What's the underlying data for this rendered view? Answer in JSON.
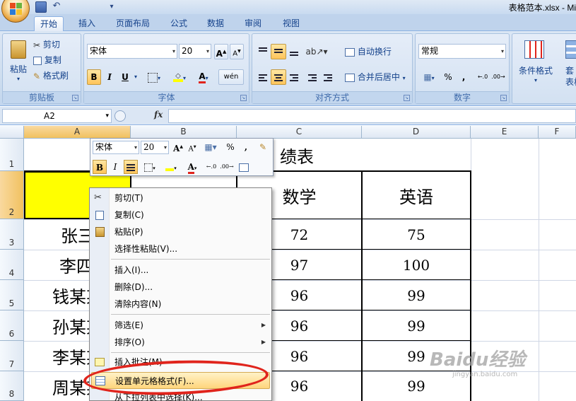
{
  "window": {
    "title": "表格范本.xlsx - Mi"
  },
  "tabs": [
    "开始",
    "插入",
    "页面布局",
    "公式",
    "数据",
    "审阅",
    "视图"
  ],
  "ribbon": {
    "clipboard": {
      "paste": "粘贴",
      "cut": "剪切",
      "copy": "复制",
      "format_painter": "格式刷",
      "label": "剪贴板"
    },
    "font": {
      "name": "宋体",
      "size": "20",
      "bold": "B",
      "italic": "I",
      "underline": "U",
      "color_a": "A",
      "label": "字体",
      "wen": "wén"
    },
    "alignment": {
      "wrap": "自动换行",
      "merge": "合并后居中",
      "label": "对齐方式"
    },
    "number": {
      "format": "常规",
      "percent": "%",
      "comma": ",",
      "label": "数字"
    },
    "styles": {
      "conditional": "条件格式",
      "table": "套",
      "table2": "表格格"
    }
  },
  "formula_bar": {
    "name_box": "A2",
    "fx": "fx"
  },
  "columns": [
    "A",
    "B",
    "C",
    "D",
    "E",
    "F"
  ],
  "rows": [
    "1",
    "2",
    "3",
    "4",
    "5",
    "6",
    "7",
    "8"
  ],
  "sheet": {
    "title_fragment": "绩表",
    "headers": {
      "math": "数学",
      "english": "英语"
    },
    "names": [
      "张三",
      "李四",
      "钱某某",
      "孙某某",
      "李某某",
      "周某某"
    ],
    "math": [
      "72",
      "97",
      "96",
      "96",
      "96",
      "96"
    ],
    "english": [
      "75",
      "100",
      "99",
      "99",
      "99",
      "99"
    ]
  },
  "mini_toolbar": {
    "font": "宋体",
    "size": "20",
    "bold": "B",
    "italic": "I",
    "percent": "%",
    "comma": ",",
    "color_a": "A"
  },
  "context_menu": [
    {
      "label": "剪切(T)",
      "icon": "scissors-icon"
    },
    {
      "label": "复制(C)",
      "icon": "copy-icon"
    },
    {
      "label": "粘贴(P)",
      "icon": "paste-icon"
    },
    {
      "label": "选择性粘贴(V)...",
      "icon": ""
    },
    {
      "label": "插入(I)...",
      "icon": ""
    },
    {
      "label": "删除(D)...",
      "icon": ""
    },
    {
      "label": "清除内容(N)",
      "icon": ""
    },
    {
      "label": "筛选(E)",
      "icon": "",
      "submenu": true
    },
    {
      "label": "排序(O)",
      "icon": "",
      "submenu": true
    },
    {
      "label": "插入批注(M)",
      "icon": "comment-icon"
    },
    {
      "label": "设置单元格格式(F)...",
      "icon": "format-cells-icon",
      "highlighted": true
    },
    {
      "label": "从下拉列表中选择(K)...",
      "icon": ""
    }
  ],
  "watermark": {
    "brand": "Baidu经验",
    "url": "jingyan.baidu.com"
  },
  "colors": {
    "accent": "#15428b",
    "selection": "#ffff00",
    "highlight_oval": "#e0241c"
  }
}
